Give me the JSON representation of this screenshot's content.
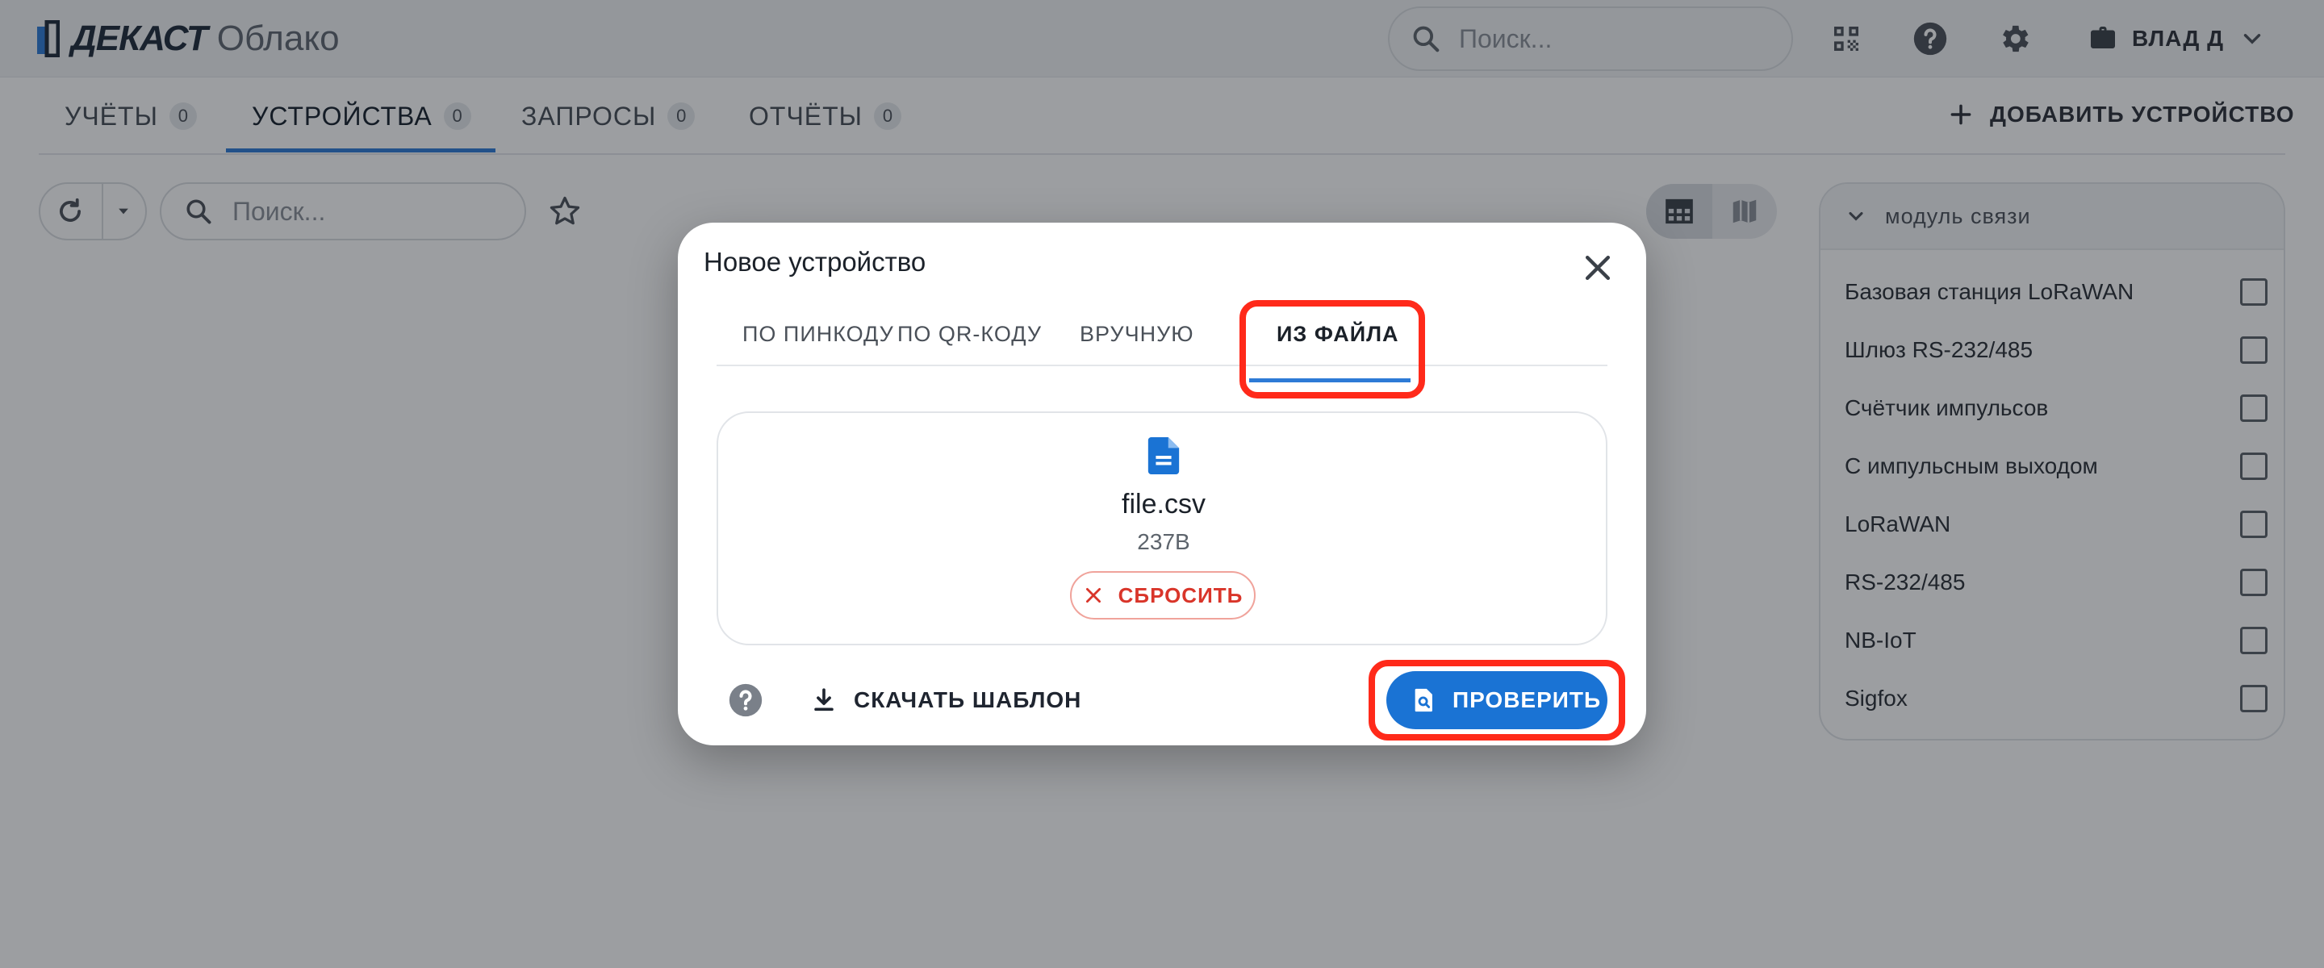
{
  "app": {
    "brand": "ДЕКАСТ",
    "product": "Облако",
    "search_placeholder": "Поиск...",
    "user_name": "ВЛАД Д"
  },
  "tabs": [
    {
      "label": "УЧЁТЫ",
      "count": "0"
    },
    {
      "label": "УСТРОЙСТВА",
      "count": "0",
      "active": true
    },
    {
      "label": "ЗАПРОСЫ",
      "count": "0"
    },
    {
      "label": "ОТЧЁТЫ",
      "count": "0"
    }
  ],
  "add_device_label": "ДОБАВИТЬ УСТРОЙСТВО",
  "toolbar": {
    "search_placeholder": "Поиск..."
  },
  "filter": {
    "title": "модуль связи",
    "items": [
      {
        "label": "Базовая станция LoRaWAN",
        "checked": false
      },
      {
        "label": "Шлюз RS-232/485",
        "checked": false
      },
      {
        "label": "Счётчик импульсов",
        "checked": false
      },
      {
        "label": "С импульсным выходом",
        "checked": false
      },
      {
        "label": "LoRaWAN",
        "checked": false
      },
      {
        "label": "RS-232/485",
        "checked": false
      },
      {
        "label": "NB-IoT",
        "checked": false
      },
      {
        "label": "Sigfox",
        "checked": false
      }
    ]
  },
  "modal": {
    "title": "Новое устройство",
    "tabs": [
      {
        "label": "ПО ПИНКОДУ"
      },
      {
        "label": "ПО QR-КОДУ"
      },
      {
        "label": "ВРУЧНУЮ"
      },
      {
        "label": "ИЗ ФАЙЛА",
        "active": true
      }
    ],
    "file": {
      "name": "file.csv",
      "size": "237B"
    },
    "reset_label": "СБРОСИТЬ",
    "download_label": "СКАЧАТЬ ШАБЛОН",
    "check_label": "ПРОВЕРИТЬ"
  },
  "colors": {
    "accent": "#1a73d4",
    "highlight": "#ff2a1a",
    "danger": "#d9352a"
  }
}
